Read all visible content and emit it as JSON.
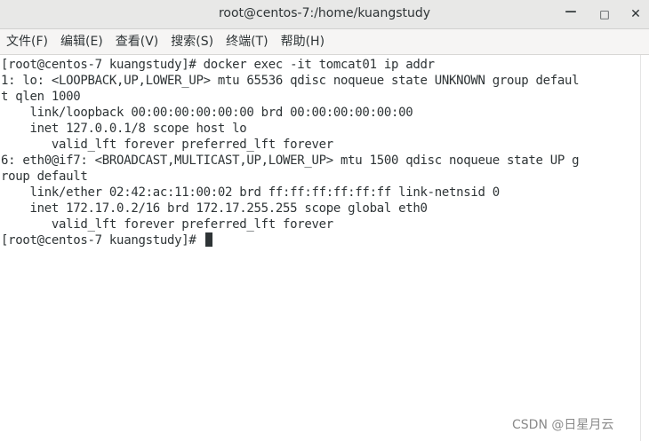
{
  "window": {
    "title": "root@centos-7:/home/kuangstudy",
    "minimize_glyph": "—",
    "maximize_glyph": "□",
    "close_glyph": "✕"
  },
  "menu": [
    {
      "label": "文件(F)"
    },
    {
      "label": "编辑(E)"
    },
    {
      "label": "查看(V)"
    },
    {
      "label": "搜索(S)"
    },
    {
      "label": "终端(T)"
    },
    {
      "label": "帮助(H)"
    }
  ],
  "terminal": {
    "lines": [
      "[root@centos-7 kuangstudy]# docker exec -it tomcat01 ip addr",
      "1: lo: <LOOPBACK,UP,LOWER_UP> mtu 65536 qdisc noqueue state UNKNOWN group defaul",
      "t qlen 1000",
      "    link/loopback 00:00:00:00:00:00 brd 00:00:00:00:00:00",
      "    inet 127.0.0.1/8 scope host lo",
      "       valid_lft forever preferred_lft forever",
      "6: eth0@if7: <BROADCAST,MULTICAST,UP,LOWER_UP> mtu 1500 qdisc noqueue state UP g",
      "roup default",
      "    link/ether 02:42:ac:11:00:02 brd ff:ff:ff:ff:ff:ff link-netnsid 0",
      "    inet 172.17.0.2/16 brd 172.17.255.255 scope global eth0",
      "       valid_lft forever preferred_lft forever"
    ],
    "prompt": "[root@centos-7 kuangstudy]# "
  },
  "watermark": "CSDN @日星月云"
}
